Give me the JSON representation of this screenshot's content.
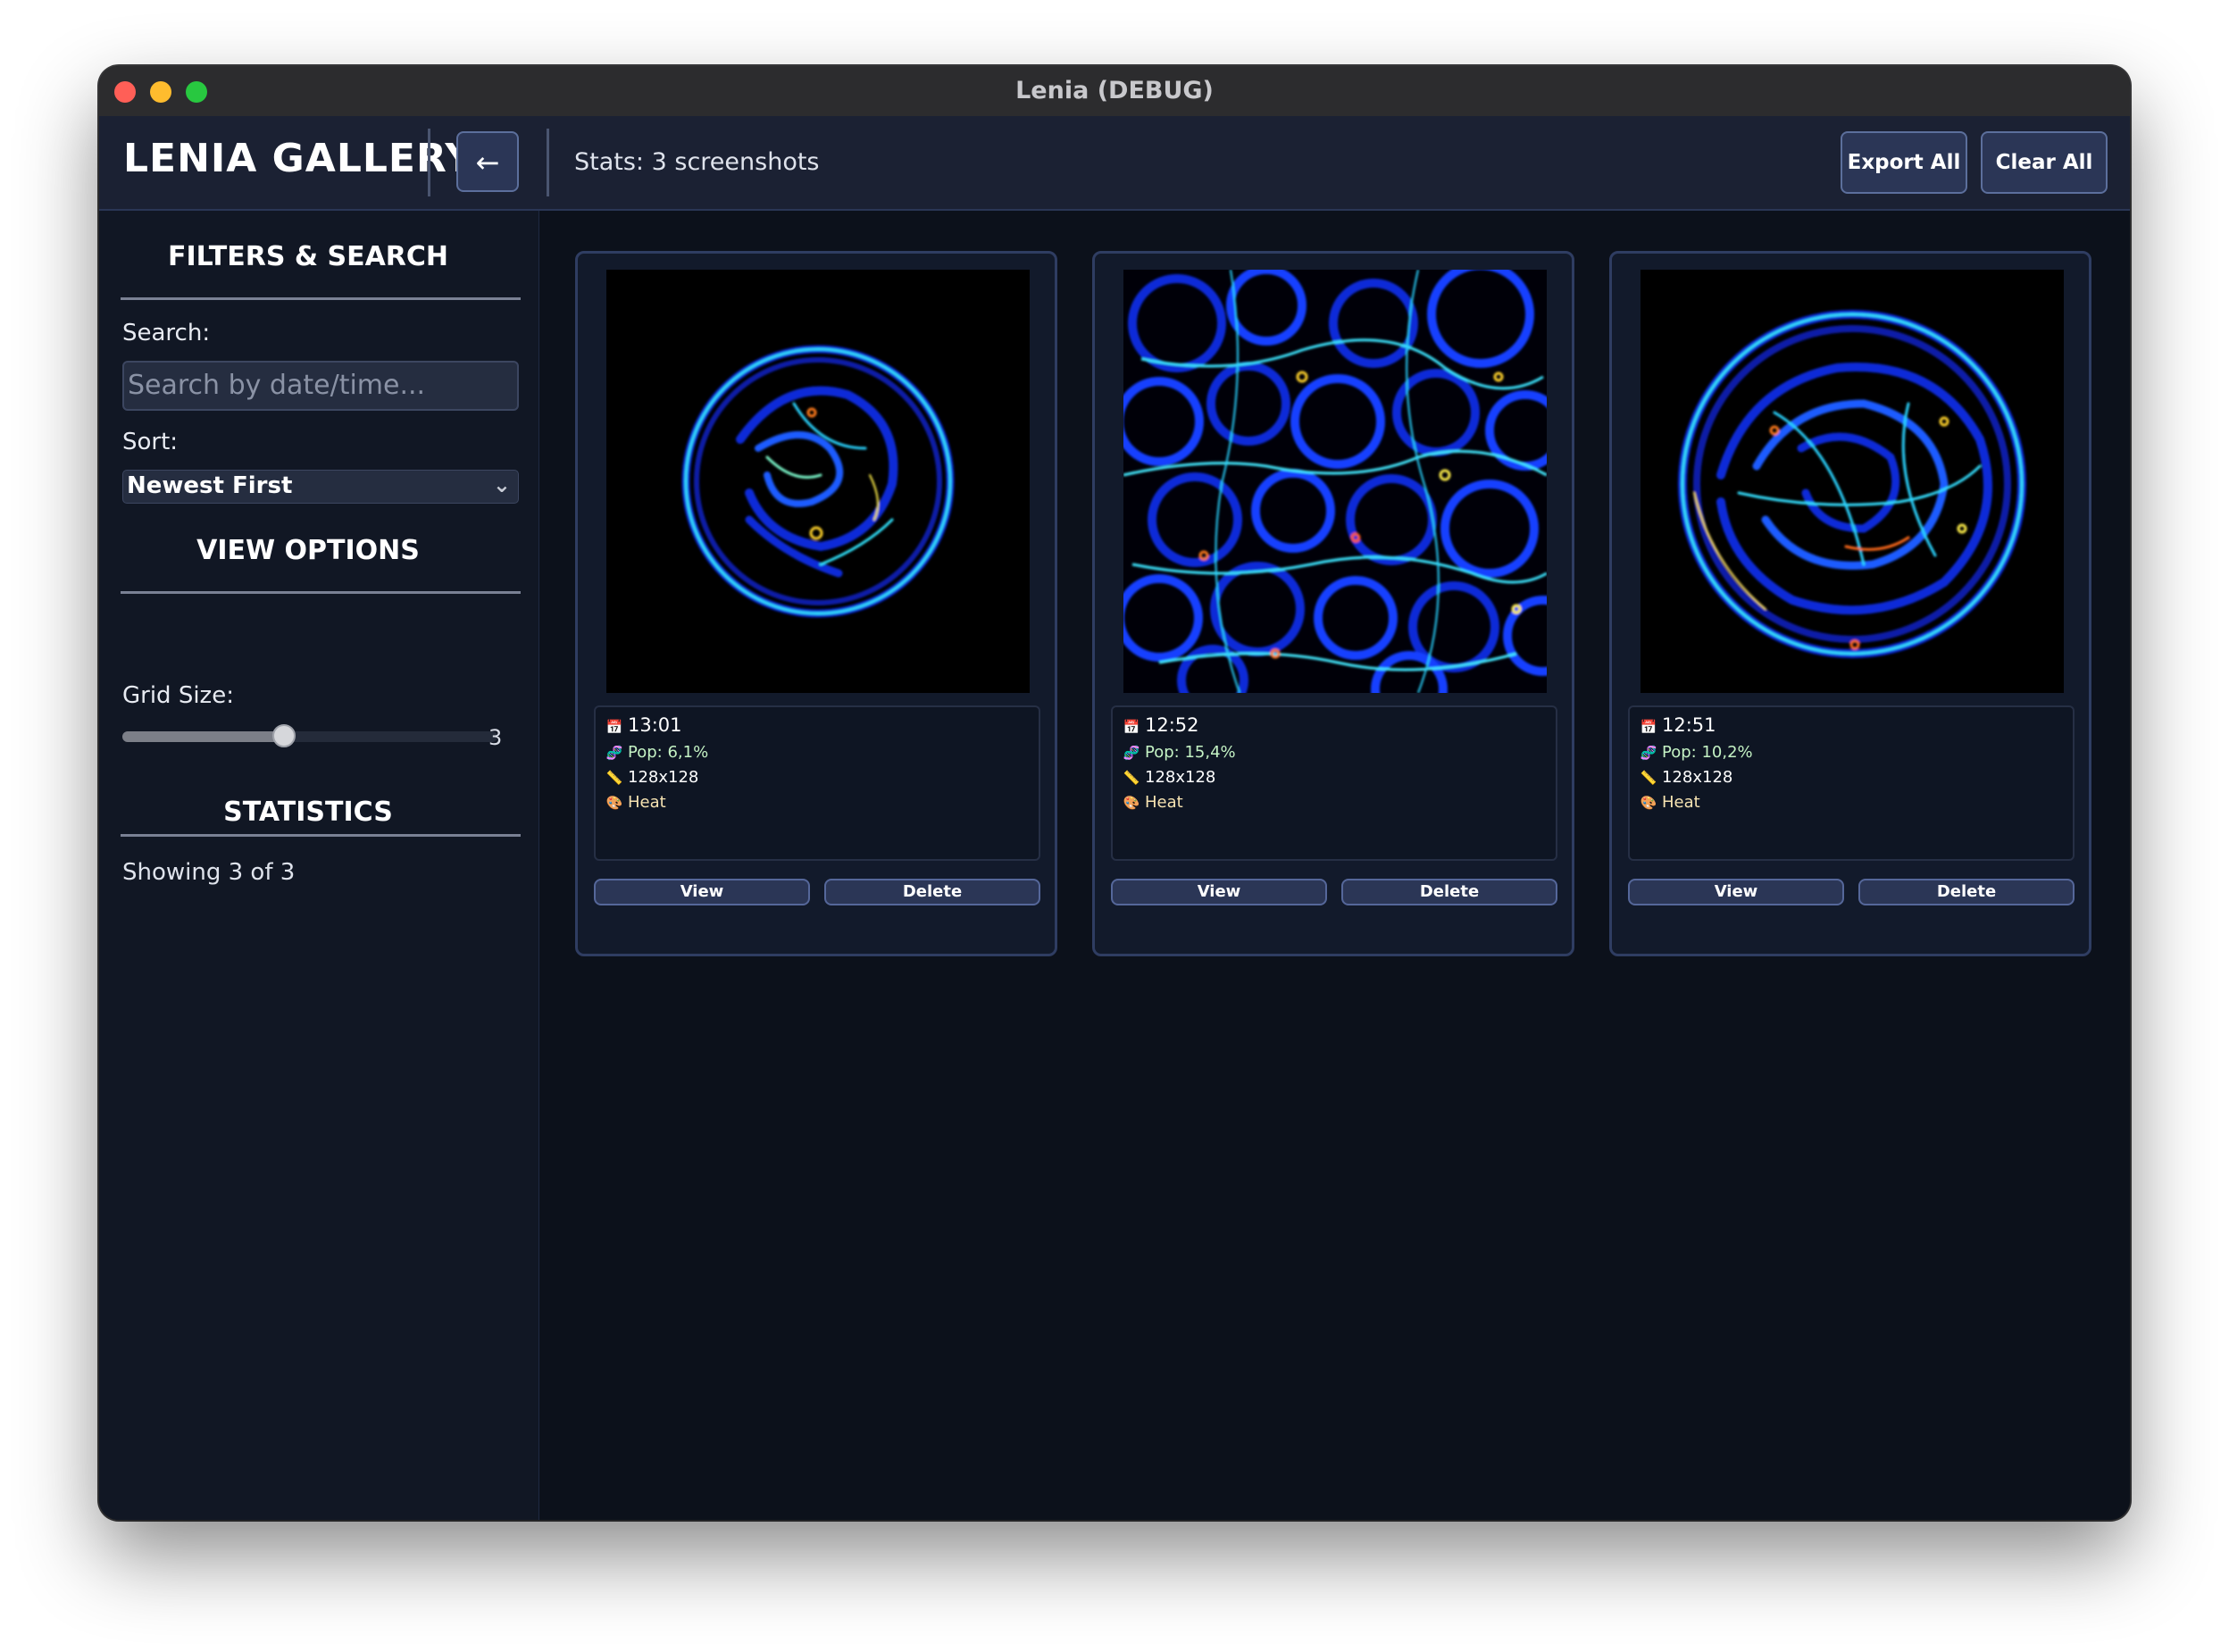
{
  "window": {
    "title": "Lenia (DEBUG)"
  },
  "header": {
    "logo": "LENIA GALLERY",
    "back_label": "←",
    "stats_label": "Stats:",
    "stats_value": "3 screenshots",
    "export_label": "Export All",
    "clear_label": "Clear All"
  },
  "sidebar": {
    "filters_title": "FILTERS & SEARCH",
    "search_label": "Search:",
    "search_placeholder": "Search by date/time...",
    "sort_label": "Sort:",
    "sort_value": "Newest First",
    "view_title": "VIEW OPTIONS",
    "grid_label": "Grid Size:",
    "grid_value": "3",
    "grid_fraction": 0.43,
    "stats_title": "STATISTICS",
    "showing": "Showing 3 of 3"
  },
  "gallery": {
    "view_label": "View",
    "delete_label": "Delete",
    "cards": [
      {
        "time": "13:01",
        "pop": "Pop: 6,1%",
        "res": "128x128",
        "cmap": "Heat"
      },
      {
        "time": "12:52",
        "pop": "Pop: 15,4%",
        "res": "128x128",
        "cmap": "Heat"
      },
      {
        "time": "12:51",
        "pop": "Pop: 10,2%",
        "res": "128x128",
        "cmap": "Heat"
      }
    ]
  },
  "icons": {
    "calendar": "calendar-icon",
    "pop": "population-icon",
    "ruler": "resolution-icon",
    "palette": "palette-icon"
  },
  "colors": {
    "accent": "#2b3656",
    "border": "#5c6f9c",
    "background": "#0c111b"
  }
}
